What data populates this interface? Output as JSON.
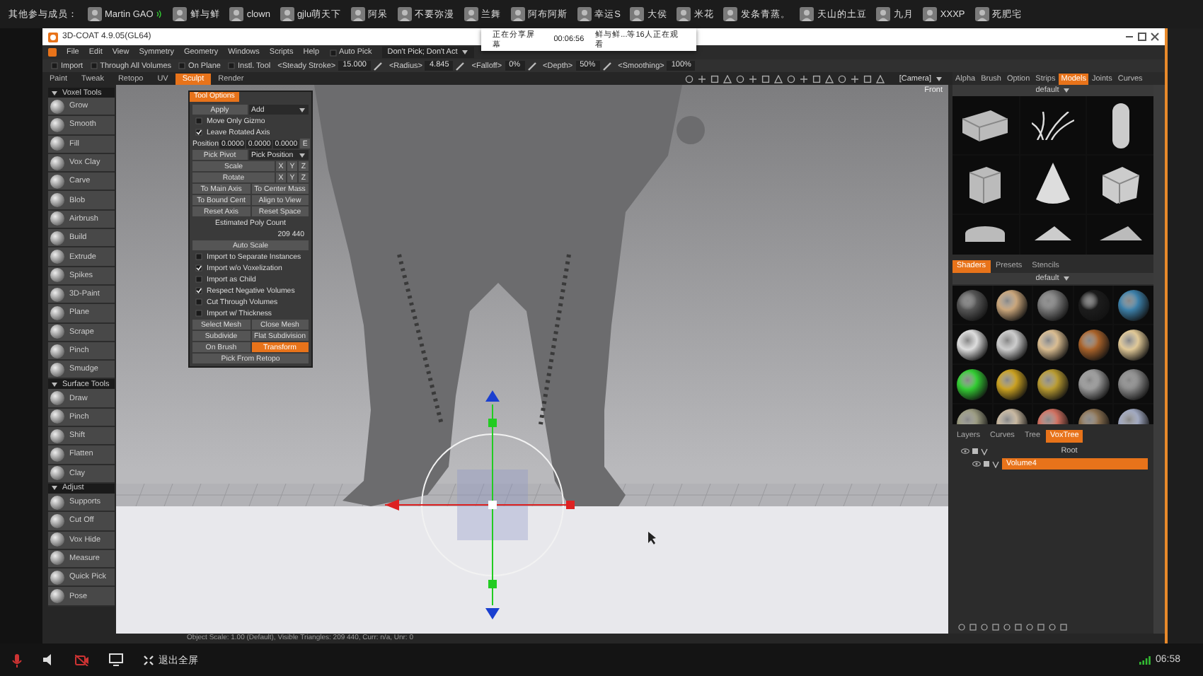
{
  "participants_bar": {
    "label": "其他参与成员：",
    "members": [
      {
        "name": "Martin GAO",
        "speaking": true
      },
      {
        "name": "鲜与鲜",
        "speaking": false
      },
      {
        "name": "clown",
        "speaking": false
      },
      {
        "name": "gjlu萌天下",
        "speaking": false
      },
      {
        "name": "阿呆",
        "speaking": false
      },
      {
        "name": "不要弥漫",
        "speaking": false
      },
      {
        "name": "兰舞",
        "speaking": false
      },
      {
        "name": "阿布阿斯",
        "speaking": false
      },
      {
        "name": "幸运S",
        "speaking": false
      },
      {
        "name": "大侯",
        "speaking": false
      },
      {
        "name": "米花",
        "speaking": false
      },
      {
        "name": "发条青蒸。",
        "speaking": false
      },
      {
        "name": "天山的土豆",
        "speaking": false
      },
      {
        "name": "九月",
        "speaking": false
      },
      {
        "name": "XXXP",
        "speaking": false
      },
      {
        "name": "死肥宅",
        "speaking": false
      }
    ]
  },
  "share_notice": {
    "status": "正在分享屏幕",
    "time": "00:06:56",
    "viewers": "鲜与鲜...等16人正在观看"
  },
  "window": {
    "title": "3D-COAT 4.9.05(GL64)"
  },
  "menu": [
    "File",
    "Edit",
    "View",
    "Symmetry",
    "Geometry",
    "Windows",
    "Scripts",
    "Help"
  ],
  "auto_pick": {
    "label": "Auto Pick",
    "checked": false
  },
  "pick_mode": "Don't Pick; Don't Act",
  "toolbar": [
    {
      "kind": "check",
      "label": "Import",
      "checked": false
    },
    {
      "kind": "check",
      "label": "Through All Volumes",
      "checked": false
    },
    {
      "kind": "check",
      "label": "On Plane",
      "checked": false
    },
    {
      "kind": "check",
      "label": "Instl. Tool",
      "checked": false
    },
    {
      "kind": "value",
      "label": "<Steady Stroke>",
      "value": "15.000"
    },
    {
      "kind": "value",
      "label": "<Radius>",
      "value": "4.845"
    },
    {
      "kind": "value",
      "label": "<Falloff>",
      "value": "0%"
    },
    {
      "kind": "value",
      "label": "<Depth>",
      "value": "50%"
    },
    {
      "kind": "value",
      "label": "<Smoothing>",
      "value": "100%"
    }
  ],
  "room_tabs": [
    {
      "label": "Paint",
      "selected": false
    },
    {
      "label": "Tweak",
      "selected": false
    },
    {
      "label": "Retopo",
      "selected": false
    },
    {
      "label": "UV",
      "selected": false
    },
    {
      "label": "Sculpt",
      "selected": true
    },
    {
      "label": "Render",
      "selected": false
    }
  ],
  "camera": "[Camera]",
  "panel_tabs": [
    {
      "label": "Alpha",
      "selected": false
    },
    {
      "label": "Brush",
      "selected": false
    },
    {
      "label": "Option",
      "selected": false
    },
    {
      "label": "Strips",
      "selected": false
    },
    {
      "label": "Models",
      "selected": true
    },
    {
      "label": "Joints",
      "selected": false
    },
    {
      "label": "Curves",
      "selected": false
    }
  ],
  "tool_groups": [
    {
      "title": "Voxel Tools",
      "tools": [
        "Grow",
        "Smooth",
        "Fill",
        "Vox Clay",
        "Carve",
        "Blob",
        "Airbrush",
        "Build",
        "Extrude",
        "Spikes",
        "3D-Paint",
        "Plane",
        "Scrape",
        "Pinch",
        "Smudge"
      ]
    },
    {
      "title": "Surface Tools",
      "tools": [
        "Draw",
        "Pinch",
        "Shift",
        "Flatten",
        "Clay"
      ]
    },
    {
      "title": "Adjust",
      "tools": [
        "Supports",
        "Cut Off",
        "Vox Hide",
        "Measure",
        "Quick Pick",
        "Pose"
      ]
    }
  ],
  "viewport": {
    "view_label": "Front"
  },
  "tool_options": {
    "title": "Tool Options",
    "rows": [
      {
        "kind": "button_dropdown",
        "button": "Apply",
        "dropdown": "Add"
      },
      {
        "kind": "check",
        "label": "Move Only Gizmo",
        "checked": false
      },
      {
        "kind": "check",
        "label": "Leave Rotated Axis",
        "checked": true
      },
      {
        "kind": "vector",
        "label": "Position",
        "values": [
          "0.0000",
          "0.0000",
          "0.0000"
        ],
        "button": "E"
      },
      {
        "kind": "button_dropdown",
        "button": "Pick Pivot",
        "dropdown": "Pick Position"
      },
      {
        "kind": "axis",
        "button": "Scale",
        "axes": [
          "X",
          "Y",
          "Z"
        ]
      },
      {
        "kind": "axis",
        "button": "Rotate",
        "axes": [
          "X",
          "Y",
          "Z"
        ]
      },
      {
        "kind": "buttons",
        "items": [
          {
            "label": "To Main Axis",
            "selected": false
          },
          {
            "label": "To Center Mass",
            "selected": false
          }
        ]
      },
      {
        "kind": "buttons",
        "items": [
          {
            "label": "To Bound Cent",
            "selected": false
          },
          {
            "label": "Align to View",
            "selected": false
          }
        ]
      },
      {
        "kind": "buttons",
        "items": [
          {
            "label": "Reset Axis",
            "selected": false
          },
          {
            "label": "Reset Space",
            "selected": false
          }
        ]
      },
      {
        "kind": "text",
        "text": "Estimated Poly Count"
      },
      {
        "kind": "value",
        "text": "209 440"
      },
      {
        "kind": "buttons",
        "items": [
          {
            "label": "Auto Scale",
            "selected": false
          }
        ]
      },
      {
        "kind": "check",
        "label": "Import to Separate Instances",
        "checked": false
      },
      {
        "kind": "check",
        "label": "Import w/o Voxelization",
        "checked": true
      },
      {
        "kind": "check",
        "label": "Import as Child",
        "checked": false
      },
      {
        "kind": "check",
        "label": "Respect Negative Volumes",
        "checked": true
      },
      {
        "kind": "check",
        "label": "Cut Through Volumes",
        "checked": false
      },
      {
        "kind": "check",
        "label": "Import w/ Thickness",
        "checked": false
      },
      {
        "kind": "buttons",
        "items": [
          {
            "label": "Select Mesh",
            "selected": false
          },
          {
            "label": "Close Mesh",
            "selected": false
          }
        ]
      },
      {
        "kind": "buttons",
        "items": [
          {
            "label": "Subdivide",
            "selected": false
          },
          {
            "label": "Flat Subdivision",
            "selected": false
          }
        ]
      },
      {
        "kind": "buttons",
        "items": [
          {
            "label": "On Brush",
            "selected": false
          },
          {
            "label": "Transform",
            "selected": true
          }
        ]
      },
      {
        "kind": "buttons",
        "items": [
          {
            "label": "Pick From Retopo",
            "selected": false
          }
        ]
      }
    ]
  },
  "models_panel": {
    "preset": "default"
  },
  "shader_tabs": [
    {
      "label": "Shaders",
      "selected": true
    },
    {
      "label": "Presets",
      "selected": false
    },
    {
      "label": "Stencils",
      "selected": false
    }
  ],
  "shaders_panel": {
    "preset": "default"
  },
  "tree_tabs": [
    {
      "label": "Layers",
      "selected": false
    },
    {
      "label": "Curves",
      "selected": false
    },
    {
      "label": "Tree",
      "selected": false
    },
    {
      "label": "VoxTree",
      "selected": true
    }
  ],
  "vox_tree": [
    {
      "label": "Root",
      "selected": false,
      "children": [
        {
          "label": "Volume4",
          "selected": true
        }
      ]
    }
  ],
  "status_bar": "Object Scale: 1.00 (Default), Visible Triangles: 209 440, Curr: n/a, Unr: 0",
  "bottom_bar": {
    "exit_fullscreen": "退出全屏",
    "time": "06:58"
  }
}
